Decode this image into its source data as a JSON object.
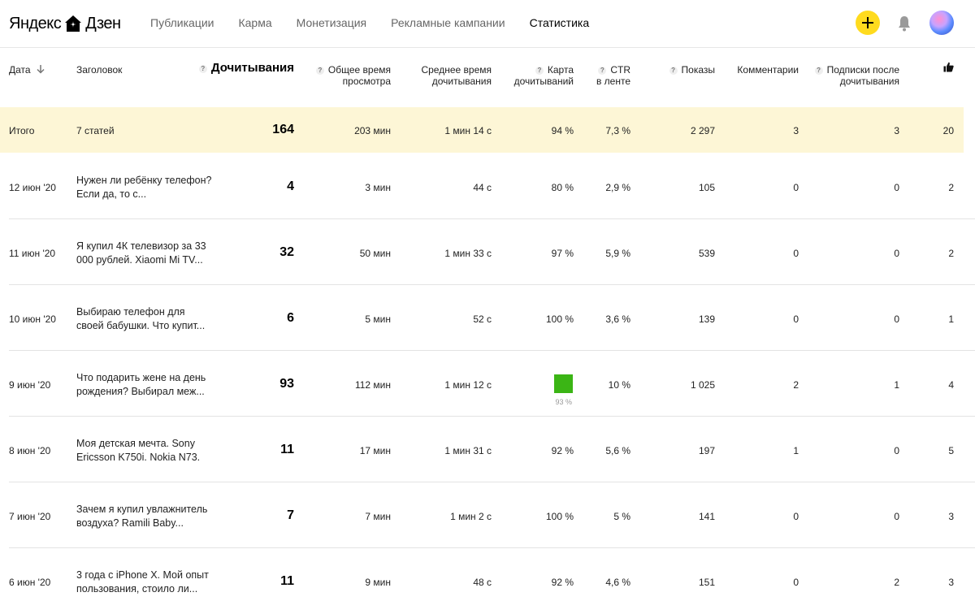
{
  "brand": {
    "left": "Яндекс",
    "right": "Дзен"
  },
  "nav": [
    {
      "label": "Публикации",
      "active": false
    },
    {
      "label": "Карма",
      "active": false
    },
    {
      "label": "Монетизация",
      "active": false
    },
    {
      "label": "Рекламные кампании",
      "active": false
    },
    {
      "label": "Статистика",
      "active": true
    }
  ],
  "header": {
    "date": "Дата",
    "title": "Заголовок",
    "reads": "Дочитывания",
    "total_time_1": "Общее время",
    "total_time_2": "просмотра",
    "avg_time_1": "Среднее время",
    "avg_time_2": "дочитывания",
    "map_1": "Карта",
    "map_2": "дочитываний",
    "ctr_1": "CTR",
    "ctr_2": "в ленте",
    "shows": "Показы",
    "comments": "Комментарии",
    "subs_1": "Подписки после",
    "subs_2": "дочитывания",
    "q": "?"
  },
  "total": {
    "label": "Итого",
    "title": "7 статей",
    "reads": "164",
    "total_time": "203 мин",
    "avg_time": "1 мин 14 с",
    "map": "94 %",
    "ctr": "7,3 %",
    "shows": "2 297",
    "comments": "3",
    "subs": "3",
    "likes": "20"
  },
  "rows": [
    {
      "date": "12 июн '20",
      "title": "Нужен ли ребёнку телефон? Если да, то с...",
      "reads": "4",
      "total_time": "3 мин",
      "avg_time": "44 с",
      "map": "80 %",
      "ctr": "2,9 %",
      "shows": "105",
      "comments": "0",
      "subs": "0",
      "likes": "2"
    },
    {
      "date": "11 июн '20",
      "title": "Я купил 4К телевизор за 33 000 рублей. Xiaomi Mi TV...",
      "reads": "32",
      "total_time": "50 мин",
      "avg_time": "1 мин 33 с",
      "map": "97 %",
      "ctr": "5,9 %",
      "shows": "539",
      "comments": "0",
      "subs": "0",
      "likes": "2"
    },
    {
      "date": "10 июн '20",
      "title": "Выбираю телефон для своей бабушки. Что купит...",
      "reads": "6",
      "total_time": "5 мин",
      "avg_time": "52 с",
      "map": "100 %",
      "ctr": "3,6 %",
      "shows": "139",
      "comments": "0",
      "subs": "0",
      "likes": "1"
    },
    {
      "date": "9 июн '20",
      "title": "Что подарить жене на день рождения? Выбирал меж...",
      "reads": "93",
      "total_time": "112 мин",
      "avg_time": "1 мин 12 с",
      "map": "93 %",
      "ctr": "10 %",
      "shows": "1 025",
      "comments": "2",
      "subs": "1",
      "likes": "4"
    },
    {
      "date": "8 июн '20",
      "title": "Моя детская мечта. Sony Ericsson K750i. Nokia N73.",
      "reads": "11",
      "total_time": "17 мин",
      "avg_time": "1 мин 31 с",
      "map": "92 %",
      "ctr": "5,6 %",
      "shows": "197",
      "comments": "1",
      "subs": "0",
      "likes": "5"
    },
    {
      "date": "7 июн '20",
      "title": "Зачем я купил увлажнитель воздуха? Ramili Baby...",
      "reads": "7",
      "total_time": "7 мин",
      "avg_time": "1 мин 2 с",
      "map": "100 %",
      "ctr": "5 %",
      "shows": "141",
      "comments": "0",
      "subs": "0",
      "likes": "3"
    },
    {
      "date": "6 июн '20",
      "title": "3 года с iPhone X. Мой опыт пользования, стоило ли...",
      "reads": "11",
      "total_time": "9 мин",
      "avg_time": "48 с",
      "map": "92 %",
      "ctr": "4,6 %",
      "shows": "151",
      "comments": "0",
      "subs": "2",
      "likes": "3"
    }
  ],
  "colors": {
    "accent_yellow": "#ffdb1e",
    "total_row_bg": "#fdf6d6",
    "map_green": "#3bb515"
  },
  "icons": [
    "house-logo-icon",
    "plus-icon",
    "bell-icon",
    "sort-arrow-down-icon",
    "help-icon",
    "like-icon"
  ]
}
